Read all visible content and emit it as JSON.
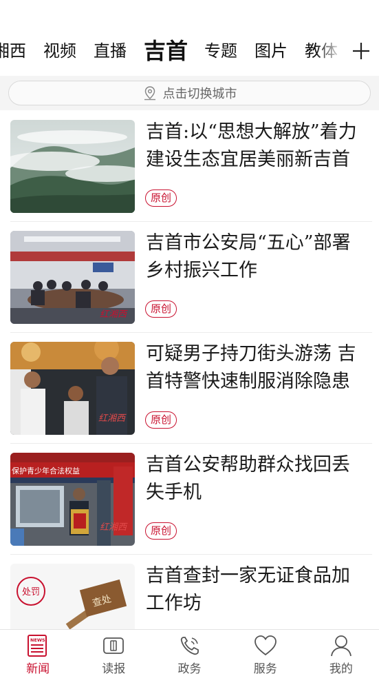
{
  "tabs": {
    "items": [
      {
        "label": "湘西"
      },
      {
        "label": "视频"
      },
      {
        "label": "直播"
      },
      {
        "label": "吉首",
        "active": true
      },
      {
        "label": "专题"
      },
      {
        "label": "图片"
      },
      {
        "label": "教体"
      }
    ],
    "add_icon": "plus-icon"
  },
  "city_bar": {
    "icon": "location-pin-icon",
    "text": "点击切换城市"
  },
  "news": [
    {
      "title": "吉首:以“思想大解放”着力建设生态宜居美丽新吉首",
      "badge": "原创"
    },
    {
      "title": "吉首市公安局“五心”部署乡村振兴工作",
      "badge": "原创"
    },
    {
      "title": "可疑男子持刀街头游荡 吉首特警快速制服消除隐患",
      "badge": "原创"
    },
    {
      "title": "吉首公安帮助群众找回丢失手机",
      "badge": "原创"
    },
    {
      "title": "吉首查封一家无证食品加工作坊",
      "badge": ""
    }
  ],
  "thumb_text": {
    "watermark": "红湘西",
    "banner": "保护青少年合法权益",
    "stamp": "处罚",
    "sign": "查处"
  },
  "bottom_nav": {
    "items": [
      {
        "label": "新闻",
        "icon": "news-icon",
        "icon_text": "NEWS",
        "active": true
      },
      {
        "label": "读报",
        "icon": "newspaper-icon"
      },
      {
        "label": "政务",
        "icon": "phone-icon"
      },
      {
        "label": "服务",
        "icon": "heart-icon"
      },
      {
        "label": "我的",
        "icon": "user-icon"
      }
    ]
  },
  "colors": {
    "accent": "#c8102e",
    "divider": "#ececec",
    "city_bg": "#f4f4f4"
  }
}
